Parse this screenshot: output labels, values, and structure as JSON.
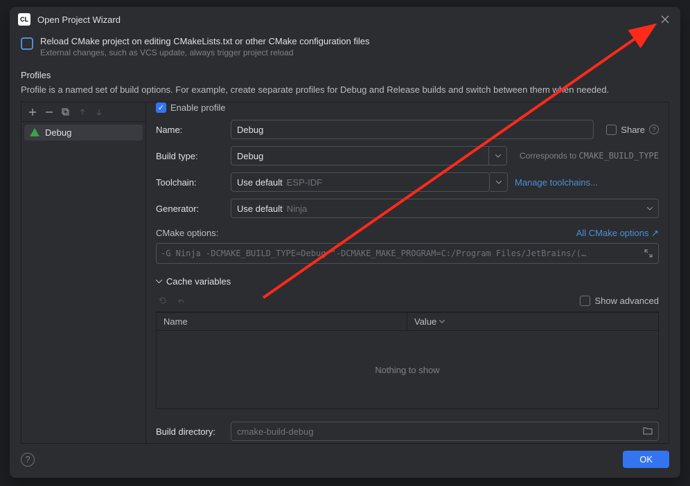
{
  "window": {
    "title": "Open Project Wizard"
  },
  "reload": {
    "label": "Reload CMake project on editing CMakeLists.txt or other CMake configuration files",
    "hint": "External changes, such as VCS update, always trigger project reload"
  },
  "profiles": {
    "heading": "Profiles",
    "description": "Profile is a named set of build options. For example, create separate profiles for Debug and Release builds and switch between them when needed.",
    "items": [
      {
        "name": "Debug"
      }
    ]
  },
  "form": {
    "enable_label": "Enable profile",
    "name_label": "Name:",
    "name_value": "Debug",
    "share_label": "Share",
    "build_type_label": "Build type:",
    "build_type_value": "Debug",
    "build_type_side": "Corresponds to ",
    "build_type_code": "CMAKE_BUILD_TYPE",
    "toolchain_label": "Toolchain:",
    "toolchain_value": "Use default",
    "toolchain_default": "ESP-IDF",
    "manage_toolchains": "Manage toolchains...",
    "generator_label": "Generator:",
    "generator_value": "Use default",
    "generator_default": "Ninja",
    "cmake_opts_label": "CMake options:",
    "all_cmake_link": "All CMake options ↗",
    "cmake_opts_value": "-G Ninja -DCMAKE_BUILD_TYPE=Debug \"-DCMAKE_MAKE_PROGRAM=C:/Program Files/JetBrains/(…",
    "cache_header": "Cache variables",
    "show_advanced": "Show advanced",
    "col_name": "Name",
    "col_value": "Value",
    "empty_text": "Nothing to show",
    "build_dir_label": "Build directory:",
    "build_dir_placeholder": "cmake-build-debug"
  },
  "footer": {
    "ok": "OK"
  }
}
